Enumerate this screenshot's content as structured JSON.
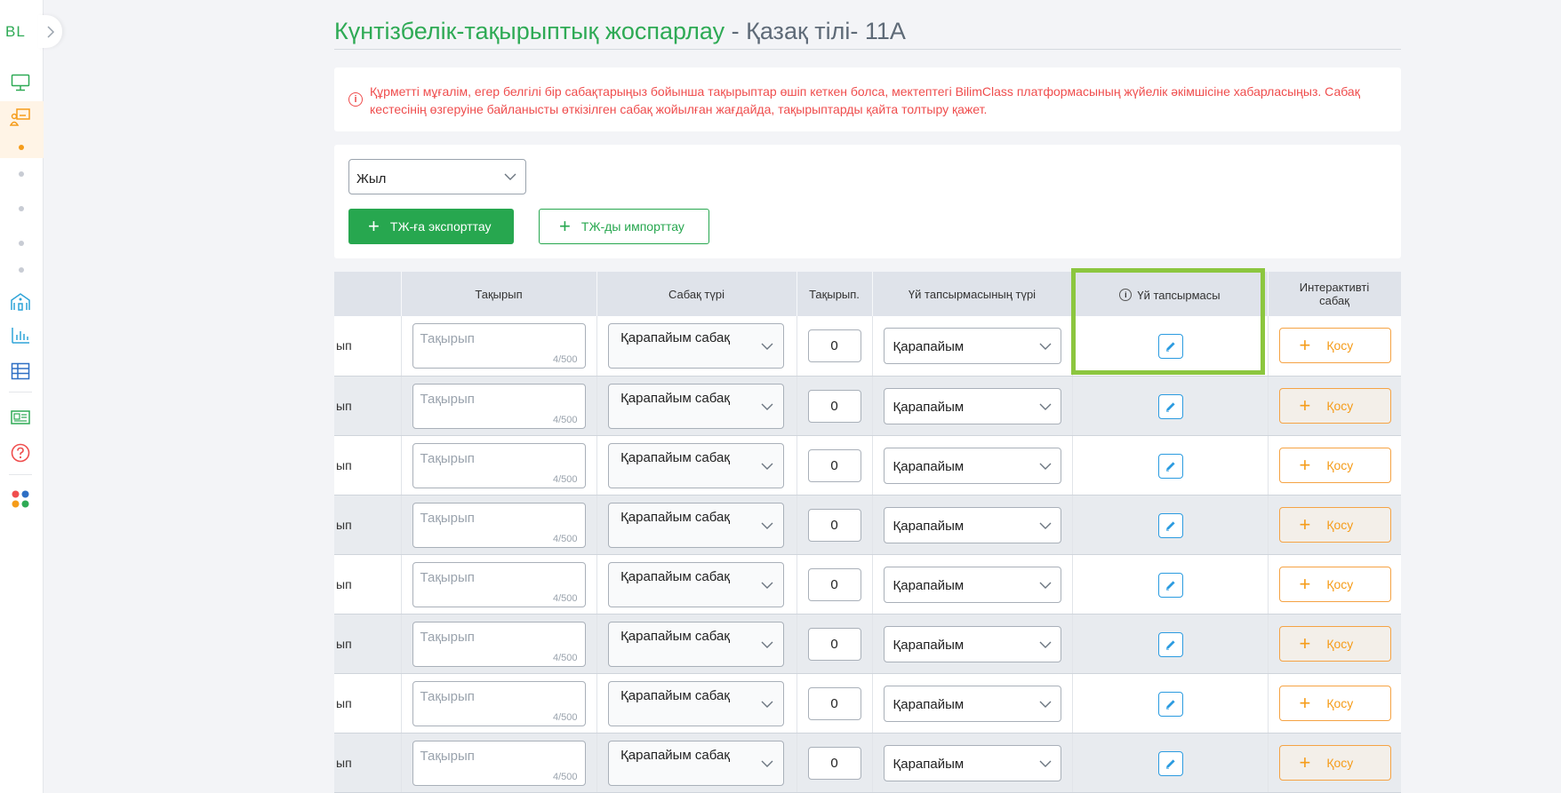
{
  "sidebar": {
    "logo": "BL",
    "icons": [
      "monitor-icon",
      "teacher-board-icon",
      "school-building-icon",
      "bar-chart-icon",
      "table-grid-icon",
      "id-card-icon",
      "help-circle-icon",
      "apps-dots-icon"
    ]
  },
  "header": {
    "title_main": "Күнтізбелік-тақырыптық жоспарлау",
    "title_suffix": " - Қазақ тілі- 11А"
  },
  "alert": {
    "text": "Құрметті мұғалім, егер белгілі бір сабақтарыңыз бойынша тақырыптар өшіп кеткен болса, мектептегі BilimClass платформасының жүйелік әкімшісіне хабарласыңыз. Сабақ кестесінің өзгеруіне байланысты өткізілген сабақ жойылған жағдайда, тақырыптарды қайта толтыру қажет."
  },
  "filters": {
    "year_select": "Жыл",
    "export_button": "ТЖ-ға экспорттау",
    "import_button": "ТЖ-ды импорттау"
  },
  "table": {
    "headers": {
      "topic": "Тақырып",
      "lesson_type": "Сабақ түрі",
      "topic_short": "Тақырып.",
      "homework_type": "Үй тапсырмасының түрі",
      "homework": "Үй тапсырмасы",
      "interactive": "Интерактивті сабақ"
    },
    "rows": [
      {
        "first": "ып",
        "topic_placeholder": "Тақырып",
        "topic_count": "4/500",
        "lesson_type": "Қарапайым сабақ",
        "number": "0",
        "homework_type": "Қарапайым",
        "add_label": "Қосу"
      },
      {
        "first": "ып",
        "topic_placeholder": "Тақырып",
        "topic_count": "4/500",
        "lesson_type": "Қарапайым сабақ",
        "number": "0",
        "homework_type": "Қарапайым",
        "add_label": "Қосу"
      },
      {
        "first": "ып",
        "topic_placeholder": "Тақырып",
        "topic_count": "4/500",
        "lesson_type": "Қарапайым сабақ",
        "number": "0",
        "homework_type": "Қарапайым",
        "add_label": "Қосу"
      },
      {
        "first": "ып",
        "topic_placeholder": "Тақырып",
        "topic_count": "4/500",
        "lesson_type": "Қарапайым сабақ",
        "number": "0",
        "homework_type": "Қарапайым",
        "add_label": "Қосу"
      },
      {
        "first": "ып",
        "topic_placeholder": "Тақырып",
        "topic_count": "4/500",
        "lesson_type": "Қарапайым сабақ",
        "number": "0",
        "homework_type": "Қарапайым",
        "add_label": "Қосу"
      },
      {
        "first": "ып",
        "topic_placeholder": "Тақырып",
        "topic_count": "4/500",
        "lesson_type": "Қарапайым сабақ",
        "number": "0",
        "homework_type": "Қарапайым",
        "add_label": "Қосу"
      },
      {
        "first": "ып",
        "topic_placeholder": "Тақырып",
        "topic_count": "4/500",
        "lesson_type": "Қарапайым сабақ",
        "number": "0",
        "homework_type": "Қарапайым",
        "add_label": "Қосу"
      },
      {
        "first": "ып",
        "topic_placeholder": "Тақырып",
        "topic_count": "4/500",
        "lesson_type": "Қарапайым сабақ",
        "number": "0",
        "homework_type": "Қарапайым",
        "add_label": "Қосу"
      }
    ]
  },
  "colors": {
    "brand_green": "#2eaa55",
    "alert_red": "#ef4d4d",
    "accent_orange": "#f59c1a",
    "edit_blue": "#2b9be0",
    "highlight_lime": "#8cc63f"
  }
}
